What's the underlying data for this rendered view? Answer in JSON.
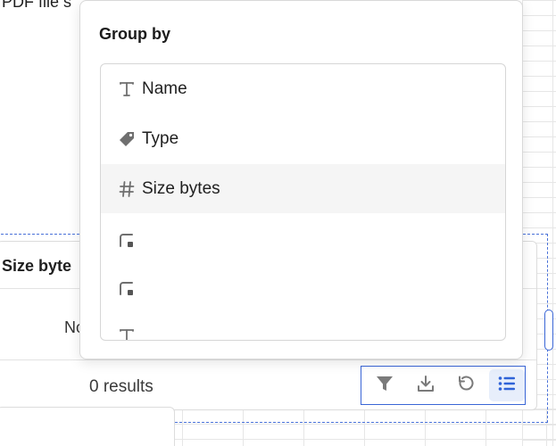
{
  "background": {
    "title_fragment": "PDF file s",
    "column_header": "Size byte",
    "cell_value": "No",
    "results_text": "0 results"
  },
  "toolbar": {
    "buttons": [
      {
        "icon": "filter-icon",
        "label": "Filter"
      },
      {
        "icon": "download-icon",
        "label": "Download"
      },
      {
        "icon": "reset-icon",
        "label": "Reset"
      },
      {
        "icon": "list-icon",
        "label": "Group by",
        "active": true
      }
    ]
  },
  "group_by_popover": {
    "title": "Group by",
    "options": [
      {
        "icon": "text-icon",
        "label": "Name"
      },
      {
        "icon": "tag-icon",
        "label": "Type"
      },
      {
        "icon": "hash-icon",
        "label": "Size bytes",
        "highlighted": true
      },
      {
        "icon": "date-icon",
        "label": ""
      },
      {
        "icon": "date-icon",
        "label": ""
      },
      {
        "icon": "text-icon",
        "label": ""
      }
    ]
  },
  "colors": {
    "accent": "#2f63d8",
    "selection_dashed": "#4a72d9",
    "hover_row": "#f5f5f5"
  }
}
